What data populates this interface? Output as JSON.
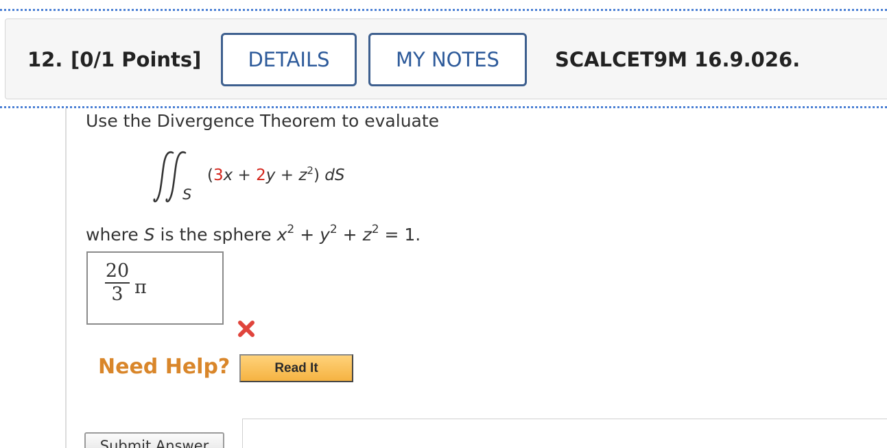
{
  "question": {
    "number": "12.",
    "points": "[0/1 Points]",
    "details_label": "DETAILS",
    "notes_label": "MY NOTES",
    "code": "SCALCET9M 16.9.026."
  },
  "problem": {
    "prompt": "Use the Divergence Theorem to evaluate",
    "integral_subscript": "S",
    "integrand": {
      "open": "(",
      "coef_x": "3",
      "var_x": "x",
      "plus1": " + ",
      "coef_y": "2",
      "var_y": "y",
      "plus2": " + ",
      "var_z": "z",
      "exp_z": "2",
      "close": ")",
      "differential": " dS"
    },
    "where": {
      "text_before": "where ",
      "S": "S",
      "text_mid": " is the sphere ",
      "x": "x",
      "y": "y",
      "z": "z",
      "exp": "2",
      "plus": " + ",
      "equals": " = 1."
    }
  },
  "answer": {
    "numerator": "20",
    "denominator": "3",
    "pi": "π",
    "status_icon": "x-mark-icon",
    "status_color": "#e0443c"
  },
  "help": {
    "label": "Need Help?",
    "read_it_label": "Read It"
  },
  "submit": {
    "label": "Submit Answer"
  },
  "colors": {
    "accent_blue": "#2d5a9a",
    "coefficient_red": "#d4261d",
    "help_orange": "#d9862a"
  }
}
